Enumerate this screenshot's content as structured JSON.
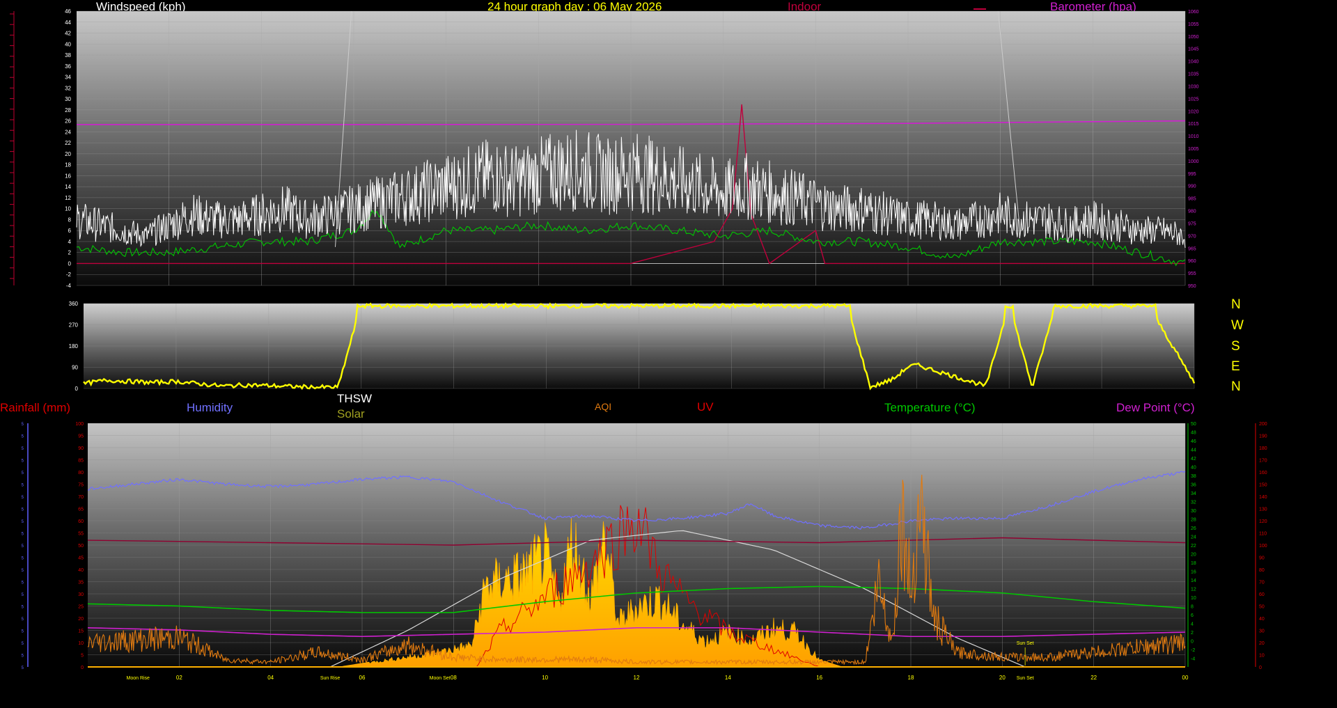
{
  "header": {
    "wind_title": "Windspeed (kph)",
    "graph_title": "24 hour graph day : 06 May 2026",
    "indoor_label": "Indoor",
    "barometer_label": "Barometer (hpa)"
  },
  "direction_labels": [
    "N",
    "W",
    "S",
    "E",
    "N"
  ],
  "bottom_header": {
    "rainfall": "Rainfall (mm)",
    "humidity": "Humidity",
    "thsw": "THSW",
    "solar": "Solar",
    "aqi": "AQI",
    "uv": "UV",
    "temperature": "Temperature (°C)",
    "dewpoint": "Dew Point (°C)"
  },
  "colors": {
    "background": "#000000",
    "wind_avg": "#ffffff",
    "wind_gust": "#00c800",
    "barometer": "#d020d0",
    "indoor": "#c0003c",
    "direction": "#ffff00",
    "humidity": "#7070ff",
    "temperature": "#00c800",
    "dewpoint": "#d020d0",
    "solar": "#ffd000",
    "aqi": "#e07a10",
    "uv": "#e00000",
    "thsw": "#900030",
    "title": "#ffff00"
  },
  "chart_data": [
    {
      "type": "line",
      "title": "24 hour graph day : 06 May 2026",
      "xlabel": "",
      "ylabel": "Windspeed (kph)",
      "y2label": "Barometer (hpa)",
      "x_ticks": [
        "02",
        "04",
        "06",
        "08",
        "10",
        "12",
        "14",
        "16",
        "18",
        "20",
        "22",
        "00"
      ],
      "ylim": [
        -4,
        46
      ],
      "y_ticks": [
        -4,
        -2,
        0,
        2,
        4,
        6,
        8,
        10,
        12,
        14,
        16,
        18,
        20,
        22,
        24,
        26,
        28,
        30,
        32,
        34,
        36,
        38,
        40,
        42,
        44,
        46
      ],
      "y2lim": [
        950,
        1060
      ],
      "y2_ticks": [
        950,
        955,
        960,
        965,
        970,
        975,
        980,
        985,
        990,
        995,
        1000,
        1005,
        1010,
        1015,
        1020,
        1025,
        1030,
        1035,
        1040,
        1045,
        1050,
        1055,
        1060
      ],
      "grid": true,
      "series": [
        {
          "name": "Windspeed (kph)",
          "x": [
            0,
            0.5,
            1,
            1.5,
            2,
            2.5,
            3,
            3.5,
            4,
            4.5,
            5,
            5.5,
            6,
            6.5,
            7,
            7.5,
            8,
            8.5,
            9,
            9.5,
            10,
            10.5,
            11,
            11.5,
            12,
            12.5,
            13,
            13.5,
            14,
            14.5,
            15,
            15.5,
            16,
            16.5,
            17,
            17.5,
            18,
            18.5,
            19,
            19.5,
            20,
            20.5,
            21,
            21.5,
            22,
            22.5,
            23,
            23.5,
            24
          ],
          "y": [
            8,
            7,
            6,
            5,
            7,
            9,
            8,
            8,
            9,
            10,
            8,
            9,
            10,
            11,
            12,
            13,
            14,
            15,
            16,
            15,
            16,
            17,
            17,
            16,
            17,
            16,
            15,
            14,
            13,
            14,
            13,
            12,
            11,
            10,
            10,
            9,
            8,
            8,
            7,
            8,
            9,
            8,
            8,
            7,
            8,
            7,
            6,
            6,
            5
          ]
        },
        {
          "name": "Gust",
          "x": [
            0,
            1,
            2,
            3,
            4,
            5,
            6,
            6.5,
            7,
            8,
            9,
            10,
            11,
            12,
            13,
            14,
            15,
            16,
            17,
            18,
            19,
            20,
            21,
            22,
            23,
            24
          ],
          "y": [
            3,
            2,
            2,
            3,
            4,
            4,
            6,
            10,
            3,
            6,
            6,
            7,
            6,
            7,
            6,
            5,
            6,
            4,
            4,
            3,
            1,
            4,
            4,
            4,
            2,
            0
          ]
        },
        {
          "name": "Barometer (hpa)",
          "x": [
            0,
            6,
            12,
            18,
            24
          ],
          "y": [
            1014.5,
            1014.5,
            1014.6,
            1015,
            1016
          ]
        },
        {
          "name": "Indoor",
          "x": [
            0,
            12,
            13.8,
            14.2,
            14.4,
            14.6,
            15,
            16,
            16.2,
            24
          ],
          "y": [
            0,
            0,
            4,
            10,
            29,
            9,
            0,
            6,
            0,
            0
          ]
        }
      ]
    },
    {
      "type": "line",
      "ylabel": "Wind Direction",
      "ylim": [
        0,
        360
      ],
      "y_ticks": [
        0,
        90,
        180,
        270,
        360
      ],
      "x_ticks": [
        "02",
        "04",
        "06",
        "08",
        "10",
        "12",
        "14",
        "16",
        "18",
        "20",
        "22",
        "00"
      ],
      "grid": true,
      "series": [
        {
          "name": "Direction",
          "x": [
            0,
            0.5,
            1,
            1.5,
            2,
            2.5,
            3,
            3.5,
            4,
            4.5,
            5,
            5.5,
            6,
            6.5,
            7,
            8,
            9,
            10,
            11,
            12,
            13,
            14,
            15,
            16,
            16.5,
            17,
            17.5,
            17.8,
            18,
            18.5,
            19,
            19.5,
            20,
            20.5,
            21,
            22,
            23,
            24
          ],
          "y": [
            20,
            35,
            30,
            25,
            30,
            20,
            10,
            15,
            12,
            8,
            5,
            5,
            360,
            345,
            350,
            350,
            345,
            350,
            340,
            345,
            345,
            340,
            345,
            345,
            350,
            5,
            40,
            90,
            100,
            70,
            40,
            10,
            360,
            5,
            350,
            350,
            355,
            25
          ]
        }
      ]
    },
    {
      "type": "area",
      "ylabel_left": "Rainfall (mm)",
      "ylabel_humidity": "Humidity",
      "ylabel_right": "Temperature (°C)",
      "x_ticks": [
        "02",
        "04",
        "06",
        "08",
        "10",
        "12",
        "14",
        "16",
        "18",
        "20",
        "22",
        "00"
      ],
      "humidity_lim": [
        0,
        100
      ],
      "humidity_ticks": [
        0,
        5,
        10,
        15,
        20,
        25,
        30,
        35,
        40,
        45,
        50,
        55,
        60,
        65,
        70,
        75,
        80,
        85,
        90,
        95,
        100
      ],
      "temp_lim": [
        -6,
        50
      ],
      "temp_ticks": [
        -4,
        -2,
        0,
        2,
        4,
        6,
        8,
        10,
        12,
        14,
        16,
        18,
        20,
        22,
        24,
        26,
        28,
        30,
        32,
        34,
        36,
        38,
        40,
        42,
        44,
        46,
        48,
        50
      ],
      "uv_lim": [
        0,
        200
      ],
      "uv_ticks": [
        0,
        10,
        20,
        30,
        40,
        50,
        60,
        70,
        80,
        90,
        100,
        110,
        120,
        130,
        140,
        150,
        160,
        170,
        180,
        190,
        200
      ],
      "annotations": [
        {
          "text": "Moon Rise",
          "x": 1.1
        },
        {
          "text": "Sun Rise",
          "x": 5.3
        },
        {
          "text": "Moon Set",
          "x": 7.7
        },
        {
          "text": "Sun Set",
          "x": 20.5
        },
        {
          "text": "Sun Set",
          "x": 20.5,
          "upper": true
        }
      ],
      "grid": true,
      "series": [
        {
          "name": "Humidity",
          "x": [
            0,
            1,
            2,
            3,
            4,
            5,
            6,
            7,
            8,
            9,
            10,
            11,
            12,
            13,
            14,
            14.5,
            15,
            16,
            17,
            18,
            19,
            20,
            21,
            22,
            23,
            24
          ],
          "y": [
            73,
            75,
            77,
            75,
            74,
            75,
            77,
            78,
            76,
            68,
            61,
            62,
            60,
            61,
            63,
            67,
            62,
            58,
            57,
            60,
            61,
            61,
            66,
            72,
            77,
            80
          ]
        },
        {
          "name": "THSW",
          "x": [
            0,
            4,
            8,
            12,
            16,
            20,
            24
          ],
          "y": [
            52,
            51,
            50,
            52,
            51,
            53,
            51
          ]
        },
        {
          "name": "Temperature (°C)",
          "x": [
            0,
            2,
            4,
            6,
            8,
            10,
            12,
            14,
            16,
            18,
            20,
            22,
            24
          ],
          "y": [
            8.5,
            8,
            7,
            6.5,
            6.5,
            9,
            11,
            12,
            12.5,
            12,
            11,
            9,
            7.5
          ]
        },
        {
          "name": "Dew Point (°C)",
          "x": [
            0,
            2,
            4,
            6,
            8,
            10,
            12,
            14,
            16,
            18,
            20,
            22,
            24
          ],
          "y": [
            3,
            2.5,
            1.5,
            1,
            1.5,
            2,
            3,
            3,
            2,
            1,
            1,
            1.5,
            2
          ]
        },
        {
          "name": "Solar",
          "x": [
            0,
            5.5,
            6.5,
            7.5,
            8.4,
            8.7,
            9,
            9.5,
            10,
            10.3,
            10.6,
            11,
            11.3,
            11.6,
            12,
            12.5,
            13,
            13.5,
            14,
            14.5,
            15,
            15.5,
            16,
            16.5,
            24
          ],
          "y": [
            0,
            0,
            3,
            6,
            10,
            38,
            40,
            43,
            52,
            30,
            60,
            32,
            62,
            20,
            28,
            32,
            20,
            12,
            16,
            12,
            18,
            16,
            3,
            0,
            0
          ]
        },
        {
          "name": "AQI",
          "x": [
            0,
            1,
            2,
            2.5,
            3,
            4,
            5,
            6,
            7,
            8,
            9,
            10,
            11,
            12,
            13,
            14,
            15,
            16,
            17,
            17.3,
            17.6,
            17.8,
            18,
            18.2,
            18.5,
            19,
            20,
            21,
            22,
            23,
            24
          ],
          "y": [
            10,
            11,
            12,
            8,
            3,
            2,
            6,
            3,
            9,
            4,
            3,
            3,
            3,
            2,
            2,
            2,
            2,
            2,
            2,
            35,
            10,
            64,
            30,
            70,
            20,
            6,
            4,
            4,
            6,
            8,
            10
          ]
        },
        {
          "name": "UV",
          "x": [
            0,
            8.5,
            9,
            10,
            11,
            12,
            12.5,
            13,
            14,
            15,
            16,
            24
          ],
          "y": [
            0,
            0,
            30,
            60,
            90,
            130,
            85,
            60,
            30,
            15,
            0,
            0
          ]
        },
        {
          "name": "Sun path",
          "x": [
            5.3,
            7,
            9,
            11,
            13,
            15,
            17,
            19,
            20.5
          ],
          "y": [
            0,
            15,
            36,
            52,
            56,
            48,
            32,
            12,
            0
          ]
        }
      ]
    }
  ]
}
